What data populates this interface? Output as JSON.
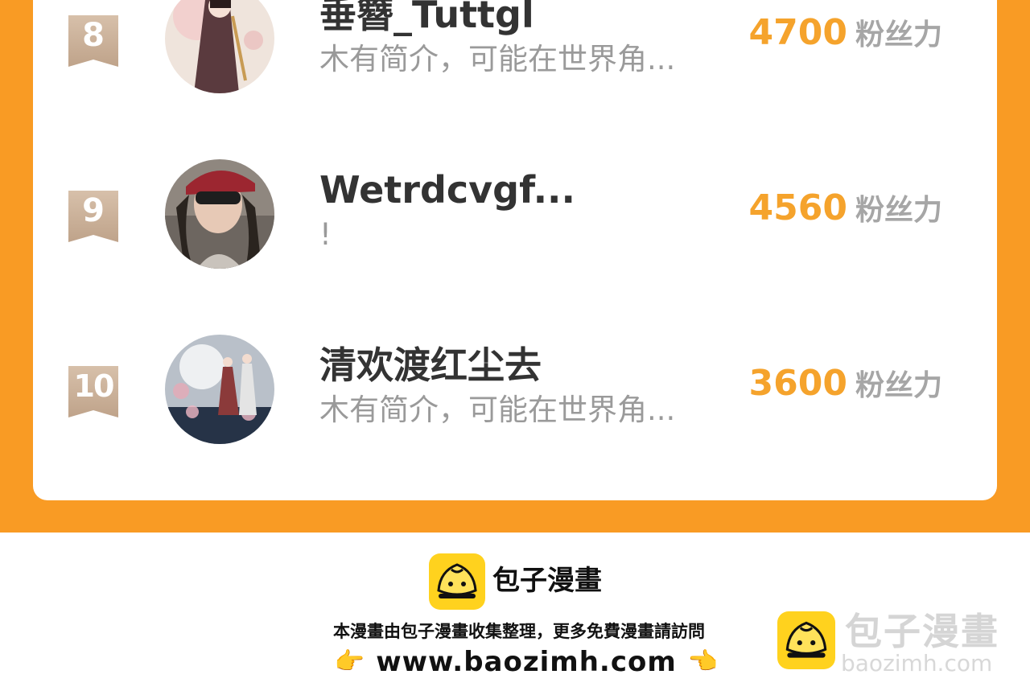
{
  "colors": {
    "accent": "#F99B24",
    "fans_number": "#F5A32C",
    "brand_yellow": "#FFD21E"
  },
  "ranking": [
    {
      "rank": "8",
      "name": "垂簪_Tuttgl",
      "desc": "木有简介，可能在世界角...",
      "fans": "4700",
      "unit": "粉丝力"
    },
    {
      "rank": "9",
      "name": "Wetrdcvgf...",
      "desc": "!",
      "fans": "4560",
      "unit": "粉丝力"
    },
    {
      "rank": "10",
      "name": "清欢渡红尘去",
      "desc": "木有简介，可能在世界角...",
      "fans": "3600",
      "unit": "粉丝力"
    }
  ],
  "footer": {
    "brand": "包子漫畫",
    "note": "本漫畫由包子漫畫收集整理，更多免費漫畫請訪問",
    "url": "www.baozimh.com",
    "hand_left": "👉",
    "hand_right": "👈"
  },
  "watermark": {
    "name": "包子漫畫",
    "url": "baozimh.com"
  }
}
